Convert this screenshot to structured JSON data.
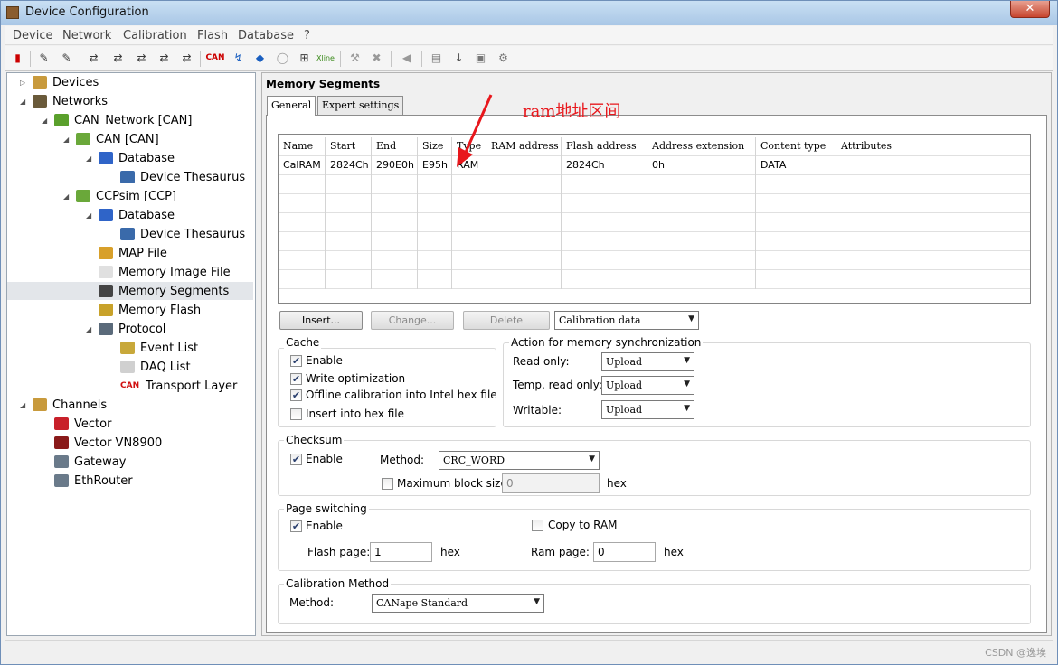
{
  "window": {
    "title": "Device Configuration",
    "close_glyph": "✕"
  },
  "menu": [
    "Device",
    "Network",
    "Calibration",
    "Flash",
    "Database",
    "?"
  ],
  "toolbar_icons": [
    "exit-icon",
    "connect-icon",
    "disconnect-icon",
    "network-1-icon",
    "network-2-icon",
    "network-3-icon",
    "network-4-icon",
    "network-5-icon",
    "can-icon",
    "lin-icon",
    "flexray-icon",
    "ethernet-icon",
    "network-node-icon",
    "xline-icon",
    "tools-icon",
    "delete-icon",
    "audio-icon",
    "database-icon",
    "download-icon",
    "parameter-icon",
    "settings-icon"
  ],
  "tree": [
    {
      "label": "Devices",
      "level": 0,
      "expander": "▷",
      "icon": "devices-icon"
    },
    {
      "label": "Networks",
      "level": 0,
      "expander": "◢",
      "icon": "networks-icon"
    },
    {
      "label": "CAN_Network [CAN]",
      "level": 1,
      "expander": "◢",
      "icon": "can-network-icon"
    },
    {
      "label": "CAN [CAN]",
      "level": 2,
      "expander": "◢",
      "icon": "can-device-icon"
    },
    {
      "label": "Database",
      "level": 3,
      "expander": "◢",
      "icon": "database-icon"
    },
    {
      "label": "Device Thesaurus",
      "level": 4,
      "expander": "",
      "icon": "thesaurus-icon"
    },
    {
      "label": "CCPsim [CCP]",
      "level": 2,
      "expander": "◢",
      "icon": "ccp-device-icon"
    },
    {
      "label": "Database",
      "level": 3,
      "expander": "◢",
      "icon": "database-icon"
    },
    {
      "label": "Device Thesaurus",
      "level": 4,
      "expander": "",
      "icon": "thesaurus-icon"
    },
    {
      "label": "MAP File",
      "level": 3,
      "expander": "",
      "icon": "map-file-icon"
    },
    {
      "label": "Memory Image File",
      "level": 3,
      "expander": "",
      "icon": "memory-image-icon"
    },
    {
      "label": "Memory Segments",
      "level": 3,
      "expander": "",
      "icon": "memory-segments-icon",
      "selected": true
    },
    {
      "label": "Memory Flash",
      "level": 3,
      "expander": "",
      "icon": "memory-flash-icon"
    },
    {
      "label": "Protocol",
      "level": 3,
      "expander": "◢",
      "icon": "protocol-icon"
    },
    {
      "label": "Event List",
      "level": 4,
      "expander": "",
      "icon": "event-list-icon"
    },
    {
      "label": "DAQ List",
      "level": 4,
      "expander": "",
      "icon": "daq-list-icon"
    },
    {
      "label": "Transport Layer",
      "level": 4,
      "expander": "",
      "icon": "transport-layer-icon",
      "icon_text": "CAN"
    },
    {
      "label": "Channels",
      "level": 0,
      "expander": "◢",
      "icon": "channels-icon"
    },
    {
      "label": "Vector",
      "level": 1,
      "expander": "",
      "icon": "vector-icon"
    },
    {
      "label": "Vector VN8900",
      "level": 1,
      "expander": "",
      "icon": "vn8900-icon"
    },
    {
      "label": "Gateway",
      "level": 1,
      "expander": "",
      "icon": "gateway-icon"
    },
    {
      "label": "EthRouter",
      "level": 1,
      "expander": "",
      "icon": "ethrouter-icon"
    }
  ],
  "panel": {
    "title": "Memory Segments",
    "tabs": [
      "General",
      "Expert settings"
    ],
    "table": {
      "columns": [
        "Name",
        "Start",
        "End",
        "Size",
        "Type",
        "RAM address",
        "Flash address",
        "Address extension",
        "Content type",
        "Attributes"
      ],
      "rows": [
        [
          "CalRAM",
          "2824Ch",
          "290E0h",
          "E95h",
          "RAM",
          "",
          "2824Ch",
          "0h",
          "DATA",
          ""
        ]
      ]
    },
    "buttons": {
      "insert": "Insert...",
      "change": "Change...",
      "delete": "Delete"
    },
    "content_filter": "Calibration data",
    "cache": {
      "title": "Cache",
      "enable": "Enable",
      "write_opt": "Write optimization",
      "offline": "Offline calibration into Intel hex file",
      "insert_hex": "Insert into hex file"
    },
    "sync": {
      "title": "Action for memory synchronization",
      "read_only_label": "Read only:",
      "read_only": "Upload",
      "temp_label": "Temp. read only:",
      "temp": "Upload",
      "writable_label": "Writable:",
      "writable": "Upload"
    },
    "checksum": {
      "title": "Checksum",
      "enable": "Enable",
      "method_label": "Method:",
      "method": "CRC_WORD",
      "max_block": "Maximum block size:",
      "max_block_value": "0",
      "unit": "hex"
    },
    "paging": {
      "title": "Page switching",
      "enable": "Enable",
      "copy_ram": "Copy to RAM",
      "flash_label": "Flash page:",
      "flash": "1",
      "ram_label": "Ram page:",
      "ram": "0",
      "unit": "hex"
    },
    "calib": {
      "title": "Calibration Method",
      "method_label": "Method:",
      "method": "CANape Standard"
    }
  },
  "annotation": "ram地址区间",
  "watermark": "CSDN @逸埃"
}
